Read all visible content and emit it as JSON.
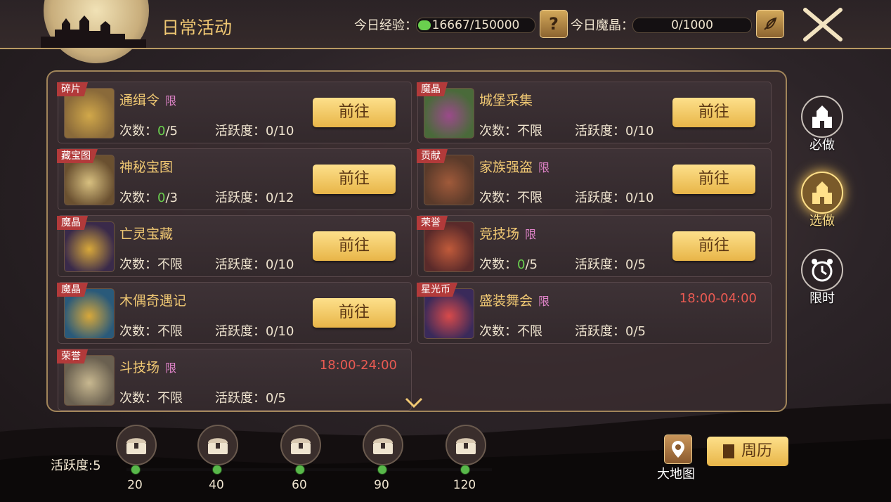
{
  "header": {
    "title": "日常活动",
    "exp_label": "今日经验：",
    "exp_value": "16667/150000",
    "exp_fraction": 0.111,
    "help_label": "?",
    "crystal_label": "今日魔晶：",
    "crystal_value": "0/1000",
    "crystal_fraction": 0
  },
  "colors": {
    "accent_gold": "#f0c873",
    "button_gold": "#fde08b",
    "limited_pink": "#e084c9",
    "time_red": "#ea5a52",
    "tag_red": "#b23a3a",
    "progress_green": "#6ad04e"
  },
  "labels": {
    "count": "次数：",
    "activity": "活跃度：",
    "go": "前往",
    "limited": "限"
  },
  "activities": [
    {
      "tag": "碎片",
      "name": "通缉令",
      "limited": true,
      "count_done": "0",
      "count_total": "/5",
      "activity": "0/10",
      "action": "前往"
    },
    {
      "tag": "魔晶",
      "name": "城堡采集",
      "limited": false,
      "count": "不限",
      "activity": "0/10",
      "action": "前往"
    },
    {
      "tag": "藏宝图",
      "name": "神秘宝图",
      "limited": false,
      "count_done": "0",
      "count_total": "/3",
      "activity": "0/12",
      "action": "前往"
    },
    {
      "tag": "贡献",
      "name": "家族强盗",
      "limited": true,
      "count": "不限",
      "activity": "0/10",
      "action": "前往"
    },
    {
      "tag": "魔晶",
      "name": "亡灵宝藏",
      "limited": false,
      "count": "不限",
      "activity": "0/10",
      "action": "前往"
    },
    {
      "tag": "荣誉",
      "name": "竞技场",
      "limited": true,
      "count_done": "0",
      "count_total": "/5",
      "activity": "0/5",
      "action": "前往"
    },
    {
      "tag": "魔晶",
      "name": "木偶奇遇记",
      "limited": false,
      "count": "不限",
      "activity": "0/10",
      "action": "前往"
    },
    {
      "tag": "星光币",
      "name": "盛装舞会",
      "limited": true,
      "count": "不限",
      "activity": "0/5",
      "time": "18:00-04:00"
    },
    {
      "tag": "荣誉",
      "name": "斗技场",
      "limited": true,
      "count": "不限",
      "activity": "0/5",
      "time": "18:00-24:00"
    }
  ],
  "side_tabs": [
    {
      "label": "必做",
      "icon": "castle-icon",
      "active": false
    },
    {
      "label": "选做",
      "icon": "castle-icon",
      "active": true
    },
    {
      "label": "限时",
      "icon": "alarm-clock-icon",
      "active": false
    }
  ],
  "activity_progress": {
    "label": "活跃度:5",
    "current": 5,
    "milestones": [
      "20",
      "40",
      "60",
      "90",
      "120"
    ]
  },
  "bottom_buttons": {
    "map_label": "大地图",
    "calendar_label": "周历"
  }
}
